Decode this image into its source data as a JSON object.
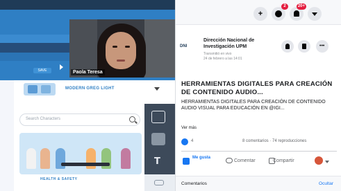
{
  "video": {
    "participant_name": "Paola Teresa"
  },
  "editor": {
    "character_name": "MODERN GREG LIGHT",
    "search_placeholder": "Search Characters",
    "thumbnail_caption": "HEALTH & SAFETY",
    "mini_button": "SAVE"
  },
  "facebook": {
    "notifications": {
      "messenger_count": "2",
      "alerts_count": "20+"
    },
    "page": {
      "logo_text": "DNI",
      "name_line1": "Dirección Nacional de",
      "name_line2": "Investigación UPM",
      "sub_line1": "Transmitió en vivo",
      "sub_line2": "24 de febrero a las 14:01"
    },
    "post": {
      "title": "HERRAMIENTAS DIGITALES PARA CREACIÓN DE CONTENIDO AUDIO...",
      "body": "HERRAMIENTAS DIGITALES PARA CREACIÓN DE CONTENIDO AUDIO VISUAL PARA EDUCACIÓN EN @IGI...",
      "see_more": "Ver más",
      "likes": "4",
      "stats": "8 comentarios · 74 reproducciones"
    },
    "actions": {
      "like": "Me gusta",
      "comment": "Comentar",
      "share": "Compartir"
    },
    "comments_bar": {
      "label": "Comentarios",
      "hide": "Ocultar"
    }
  }
}
